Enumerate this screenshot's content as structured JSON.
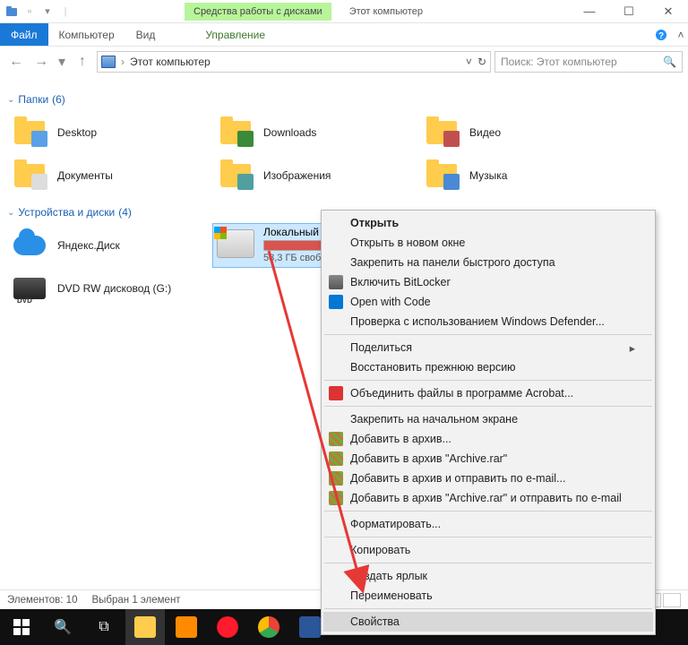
{
  "titlebar": {
    "drive_tools": "Средства работы с дисками",
    "title": "Этот компьютер"
  },
  "ribbon": {
    "file": "Файл",
    "computer": "Компьютер",
    "view": "Вид",
    "manage": "Управление"
  },
  "address": {
    "path": "Этот компьютер",
    "search_placeholder": "Поиск: Этот компьютер"
  },
  "groups": {
    "folders": {
      "title": "Папки",
      "count": "(6)"
    },
    "devices": {
      "title": "Устройства и диски",
      "count": "(4)"
    }
  },
  "folders": {
    "desktop": "Desktop",
    "downloads": "Downloads",
    "videos": "Видео",
    "documents": "Документы",
    "pictures": "Изображения",
    "music": "Музыка"
  },
  "devices": {
    "yadisk": "Яндекс.Диск",
    "dvd": "DVD RW дисковод (G:)",
    "localc": {
      "name": "Локальный",
      "sub": "58,3 ГБ своб"
    }
  },
  "context": {
    "open": "Открыть",
    "open_new": "Открыть в новом окне",
    "pin_quick": "Закрепить на панели быстрого доступа",
    "bitlocker": "Включить BitLocker",
    "open_code": "Open with Code",
    "defender": "Проверка с использованием Windows Defender...",
    "share": "Поделиться",
    "restore": "Восстановить прежнюю версию",
    "acrobat": "Объединить файлы в программе Acrobat...",
    "pin_start": "Закрепить на начальном экране",
    "add_archive": "Добавить в архив...",
    "add_archive_rar": "Добавить в архив \"Archive.rar\"",
    "add_email": "Добавить в архив и отправить по e-mail...",
    "add_rar_email": "Добавить в архив \"Archive.rar\" и отправить по e-mail",
    "format": "Форматировать...",
    "copy": "Копировать",
    "shortcut": "Создать ярлык",
    "rename": "Переименовать",
    "properties": "Свойства"
  },
  "status": {
    "elements": "Элементов: 10",
    "selected": "Выбран 1 элемент"
  }
}
